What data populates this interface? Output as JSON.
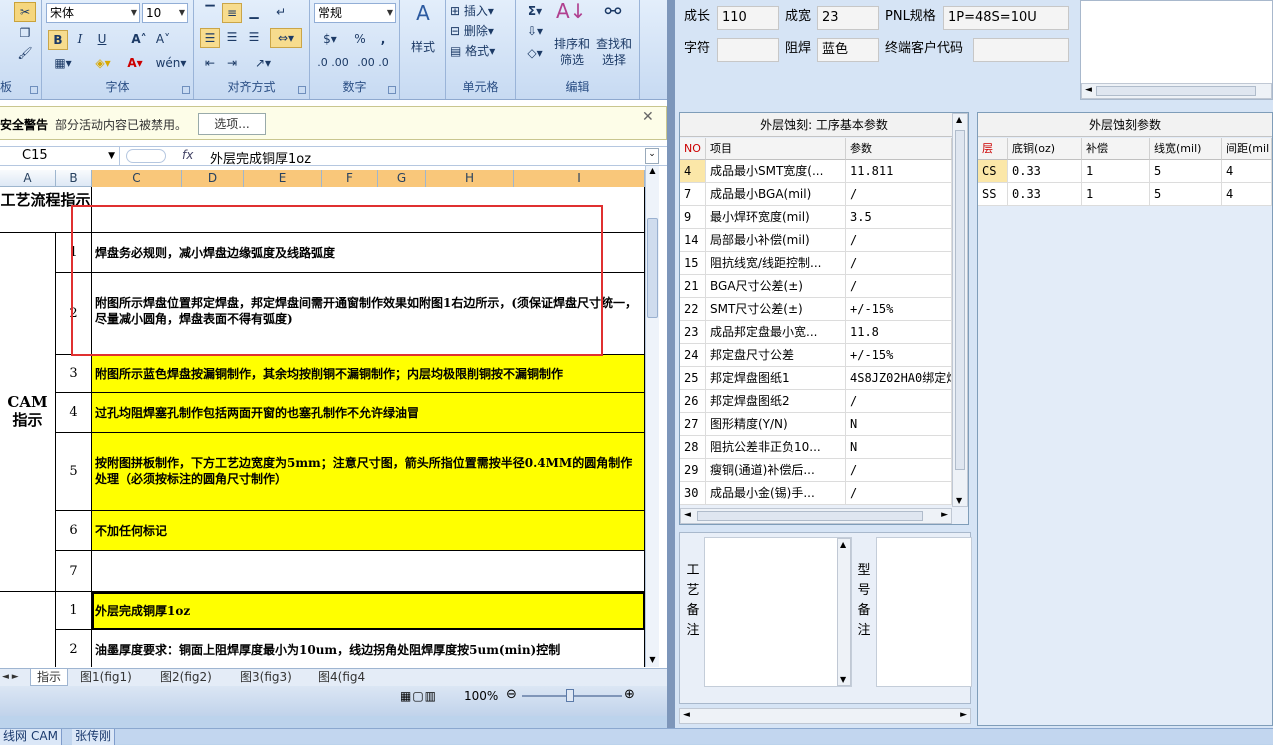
{
  "ribbon": {
    "font_name": "宋体",
    "font_size": "10",
    "number_format": "常规",
    "bold": "B",
    "italic": "I",
    "underline": "U",
    "insert": "插入",
    "delete": "删除",
    "format": "格式",
    "style": "样式",
    "sort_filter": "排序和筛选",
    "find_select": "查找和选择",
    "percent": "%",
    "comma": ",",
    "dec_inc": ".0 .00",
    "dec_dec": ".00 .0",
    "group_clipboard": "板",
    "group_font": "字体",
    "group_align": "对齐方式",
    "group_number": "数字",
    "group_cells": "单元格",
    "group_edit": "编辑"
  },
  "security": {
    "title": "安全警告",
    "message": "部分活动内容已被禁用。",
    "options_button": "选项..."
  },
  "formula_bar": {
    "cell_ref": "C15",
    "fx": "fx",
    "value": "外层完成铜厚1oz"
  },
  "columns": [
    "A",
    "B",
    "C",
    "D",
    "E",
    "F",
    "G",
    "H",
    "I"
  ],
  "sheet": {
    "header_label": "工艺流程指示",
    "cam_label": "CAM指示",
    "rows": [
      {
        "num": "1",
        "text": "焊盘务必规则，减小焊盘边缘弧度及线路弧度"
      },
      {
        "num": "2",
        "text": "附图所示焊盘位置邦定焊盘，邦定焊盘间需开通窗制作效果如附图1右边所示，(须保证焊盘尺寸统一，尽量减小圆角，焊盘表面不得有弧度)"
      },
      {
        "num": "3",
        "text": "附图所示蓝色焊盘按漏铜制作，其余均按削铜不漏铜制作；内层均极限削铜按不漏铜制作"
      },
      {
        "num": "4",
        "text": "过孔均阻焊塞孔制作包括两面开窗的也塞孔制作不允许绿油冒"
      },
      {
        "num": "5",
        "text": "按附图拼板制作，下方工艺边宽度为5mm；注意尺寸图，箭头所指位置需按半径0.4MM的圆角制作处理（必须按标注的圆角尺寸制作）"
      },
      {
        "num": "6",
        "text": "不加任何标记"
      },
      {
        "num": "7",
        "text": ""
      },
      {
        "num": "1",
        "text": "外层完成铜厚1oz"
      },
      {
        "num": "2",
        "text": "油墨厚度要求：铜面上阻焊厚度最小为10um，线边拐角处阻焊厚度按5um(min)控制"
      }
    ]
  },
  "sheet_tabs": [
    "指示",
    "图1(fig1)",
    "图2(fig2)",
    "图3(fig3)",
    "图4(fig4"
  ],
  "status": {
    "zoom": "100%"
  },
  "right": {
    "fields": {
      "chengchang_label": "成长",
      "chengchang_value": "110",
      "chengkuan_label": "成宽",
      "chengkuan_value": "23",
      "pnl_label": "PNL规格",
      "pnl_value": "1P=48S=10U",
      "zifu_label": "字符",
      "zifu_value": "",
      "zuhan_label": "阻焊",
      "zuhan_value": "蓝色",
      "customer_label": "终端客户代码",
      "customer_value": ""
    },
    "etch_basic": {
      "title": "外层蚀刻: 工序基本参数",
      "headers": [
        "NO",
        "项目",
        "参数"
      ],
      "rows": [
        [
          "4",
          "成品最小SMT宽度(...",
          "11.811"
        ],
        [
          "7",
          "成品最小BGA(mil)",
          "/"
        ],
        [
          "9",
          "最小焊环宽度(mil)",
          "3.5"
        ],
        [
          "14",
          "局部最小补偿(mil)",
          "/"
        ],
        [
          "15",
          "阻抗线宽/线距控制...",
          "/"
        ],
        [
          "21",
          "BGA尺寸公差(±)",
          "/"
        ],
        [
          "22",
          "SMT尺寸公差(±)",
          "+/-15%"
        ],
        [
          "23",
          "成品邦定盘最小宽...",
          "11.8"
        ],
        [
          "24",
          "邦定盘尺寸公差",
          "+/-15%"
        ],
        [
          "25",
          "邦定焊盘图纸1",
          "4S8JZ02HA0绑定焊"
        ],
        [
          "26",
          "邦定焊盘图纸2",
          "/"
        ],
        [
          "27",
          "图形精度(Y/N)",
          "N"
        ],
        [
          "28",
          "阻抗公差非正负10...",
          "N"
        ],
        [
          "29",
          "瘦铜(通道)补偿后...",
          "/"
        ],
        [
          "30",
          "成品最小金(锡)手...",
          "/"
        ]
      ]
    },
    "etch_params": {
      "title": "外层蚀刻参数",
      "headers": [
        "层",
        "底铜(oz)",
        "补偿",
        "线宽(mil)",
        "间距(mil"
      ],
      "rows": [
        [
          "CS",
          "0.33",
          "1",
          "5",
          "4"
        ],
        [
          "SS",
          "0.33",
          "1",
          "5",
          "4"
        ]
      ]
    },
    "remarks": {
      "process_label": "工艺备注",
      "model_label": "型号备注"
    }
  },
  "taskbar": [
    "线网",
    "CAM",
    "张传刚"
  ]
}
